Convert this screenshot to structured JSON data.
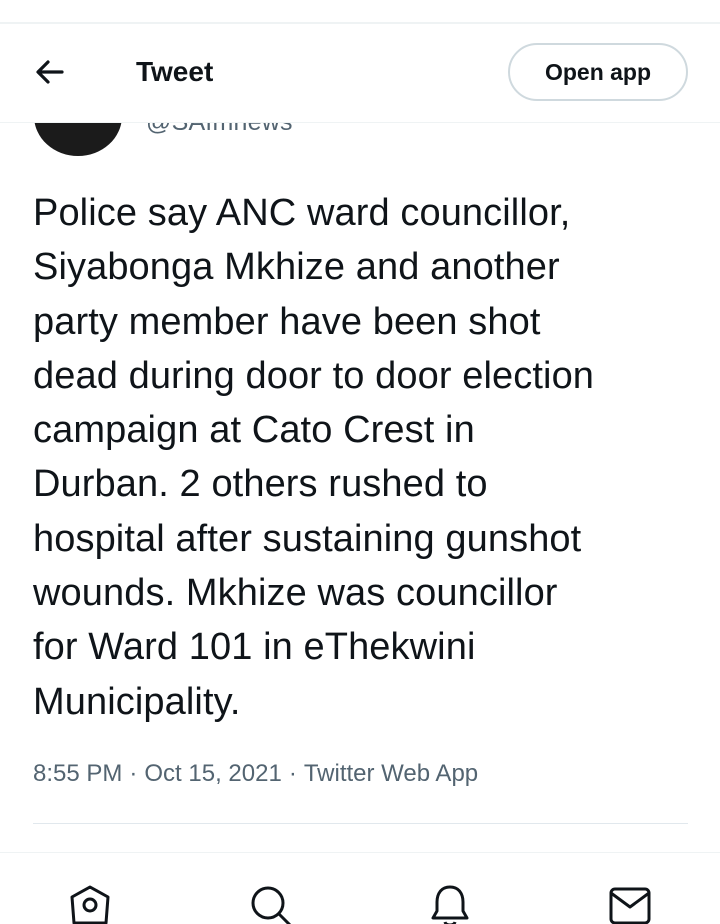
{
  "header": {
    "back_icon": "arrow-left-icon",
    "title": "Tweet",
    "open_app_label": "Open app"
  },
  "tweet": {
    "author_handle": "@SAfmnews",
    "text_lines": [
      "Police say ANC ward councillor,",
      "Siyabonga Mkhize and another",
      "party member have been shot",
      "dead during door to door election",
      "campaign at Cato Crest in",
      "Durban. 2 others rushed to",
      "hospital after sustaining gunshot",
      "wounds. Mkhize was councillor",
      "for Ward 101 in eThekwini",
      "Municipality."
    ],
    "time": "8:55 PM",
    "date": "Oct 15, 2021",
    "source": "Twitter Web App",
    "separator": "·"
  },
  "bottom_nav": {
    "items": [
      {
        "icon": "home-icon"
      },
      {
        "icon": "search-icon"
      },
      {
        "icon": "notifications-bell-icon"
      },
      {
        "icon": "messages-envelope-icon"
      }
    ]
  },
  "colors": {
    "text_primary": "#0f1419",
    "text_secondary": "#536471",
    "border": "#cfd9de"
  }
}
